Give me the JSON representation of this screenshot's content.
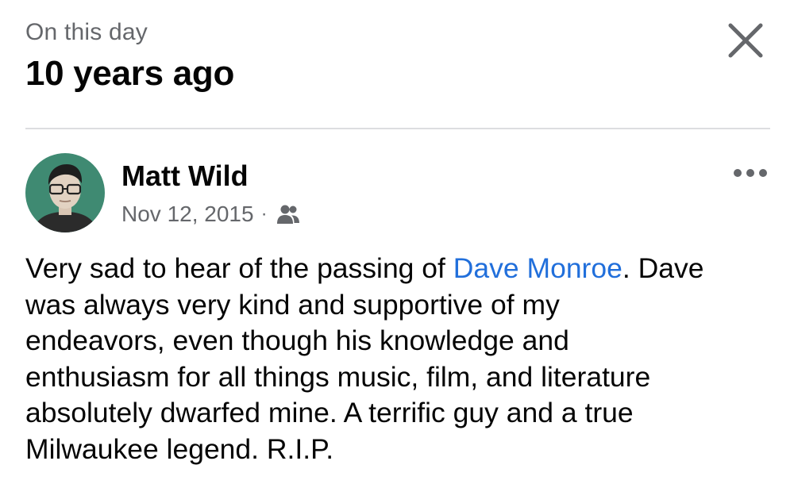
{
  "header": {
    "subtitle": "On this day",
    "title": "10 years ago",
    "close_icon": "close-x-icon"
  },
  "post": {
    "author": "Matt Wild",
    "date": "Nov 12, 2015",
    "separator": "·",
    "audience_icon": "friends-icon",
    "more_icon": "more-options-icon",
    "text_before": "Very sad to hear of the passing of ",
    "mention": "Dave Monroe",
    "text_after": ". Dave\nwas always very kind and supportive of my\nendeavors, even though his knowledge and\nenthusiasm for all things music, film, and literature\nabsolutely dwarfed mine. A terrific guy and a true\nMilwaukee legend. R.I.P."
  },
  "colors": {
    "secondary_text": "#65676b",
    "link": "#216fdb",
    "avatar_bg": "#3f8a72",
    "divider": "#dcdde0"
  }
}
